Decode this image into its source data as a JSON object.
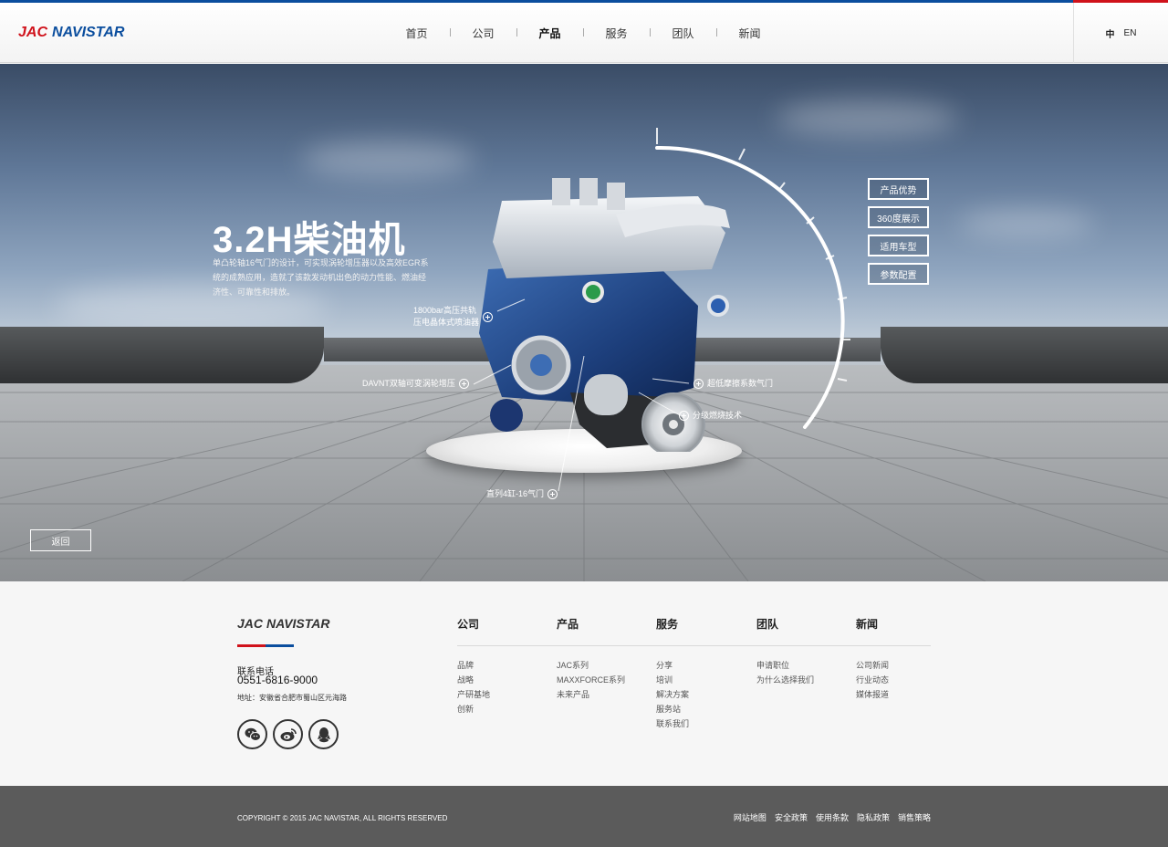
{
  "brand": {
    "jac": "JAC",
    "navistar": "NAVISTAR"
  },
  "nav": {
    "items": [
      {
        "label": "首页",
        "active": false
      },
      {
        "label": "公司",
        "active": false
      },
      {
        "label": "产品",
        "active": true
      },
      {
        "label": "服务",
        "active": false
      },
      {
        "label": "团队",
        "active": false
      },
      {
        "label": "新闻",
        "active": false
      }
    ],
    "lang_zh": "中",
    "lang_en": "EN"
  },
  "hero": {
    "title": "3.2H柴油机",
    "description": "单凸轮轴16气门的设计，可实现涡轮增压器以及高效EGR系统的成熟应用，造就了该款发动机出色的动力性能、燃油经济性、可靠性和排放。",
    "callouts": {
      "rail": "1800bar高压共轨\n压电晶体式喷油器",
      "turbo": "DAVNT双轴可变涡轮增压",
      "egr": "超低摩擦系数气门",
      "combustion": "分级燃烧技术",
      "valves": "直列4缸-16气门"
    },
    "side_buttons": [
      "产品优势",
      "360度展示",
      "适用车型",
      "参数配置"
    ],
    "back_label": "返回"
  },
  "footer": {
    "contact_label": "联系电话",
    "phone": "0551-6816-9000",
    "address": "地址：安徽省合肥市蜀山区元海路",
    "columns": [
      {
        "head": "公司",
        "links": [
          "品牌",
          "战略",
          "产研基地",
          "创新"
        ]
      },
      {
        "head": "产品",
        "links": [
          "JAC系列",
          "MAXXFORCE系列",
          "未来产品"
        ]
      },
      {
        "head": "服务",
        "links": [
          "分享",
          "培训",
          "解决方案",
          "服务站",
          "联系我们"
        ]
      },
      {
        "head": "团队",
        "links": [
          "申请职位",
          "为什么选择我们"
        ]
      },
      {
        "head": "新闻",
        "links": [
          "公司新闻",
          "行业动态",
          "媒体报道"
        ]
      }
    ],
    "copyright": "COPYRIGHT © 2015 JAC NAVISTAR, ALL RIGHTS RESERVED",
    "bottom_links": [
      "网站地图",
      "安全政策",
      "使用条款",
      "隐私政策",
      "销售策略"
    ]
  },
  "colors": {
    "brand_red": "#d0121b",
    "brand_blue": "#0b4e9e",
    "footer_bar": "#5b5b5b"
  }
}
